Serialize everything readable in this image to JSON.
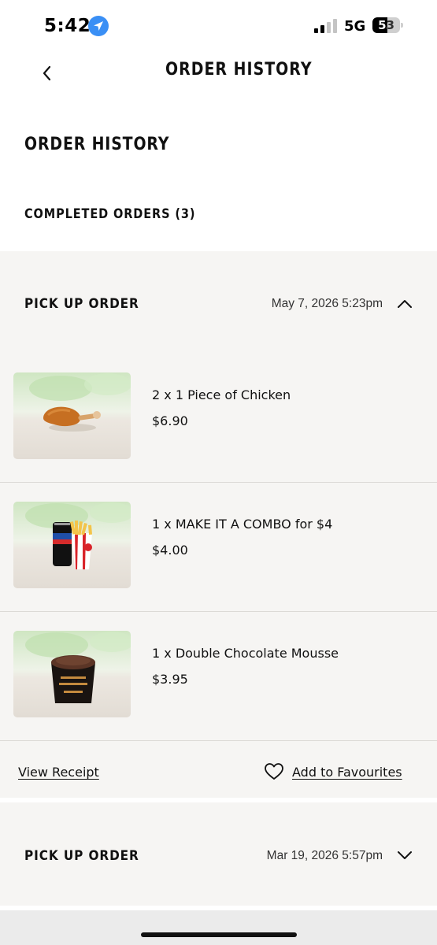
{
  "status_bar": {
    "time": "5:42",
    "network": "5G",
    "battery": "53",
    "battery_level": 0.53,
    "location_icon": "location-arrow-icon",
    "signal_icon": "cellular-signal-icon"
  },
  "header": {
    "title": "ORDER HISTORY",
    "back_icon": "chevron-left-icon"
  },
  "page": {
    "title": "ORDER HISTORY",
    "section_label": "COMPLETED ORDERS (3)"
  },
  "orders": [
    {
      "type": "PICK UP ORDER",
      "date": "May 7, 2026 5:23pm",
      "expanded": true,
      "items": [
        {
          "name": "2 x 1 Piece of Chicken",
          "price": "$6.90",
          "image_icon": "fried-chicken-drumstick-image"
        },
        {
          "name": "1 x MAKE IT A COMBO for $4",
          "price": "$4.00",
          "image_icon": "pepsi-and-fries-image"
        },
        {
          "name": "1 x Double Chocolate Mousse",
          "price": "$3.95",
          "image_icon": "chocolate-mousse-cup-image"
        }
      ],
      "view_receipt_label": "View Receipt",
      "add_favourites_label": "Add to Favourites"
    },
    {
      "type": "PICK UP ORDER",
      "date": "Mar 19, 2026 5:57pm",
      "expanded": false
    }
  ],
  "colors": {
    "card_bg": "#f6f5f3",
    "location_blue": "#3a8ff5",
    "divider": "#dcdad6"
  }
}
